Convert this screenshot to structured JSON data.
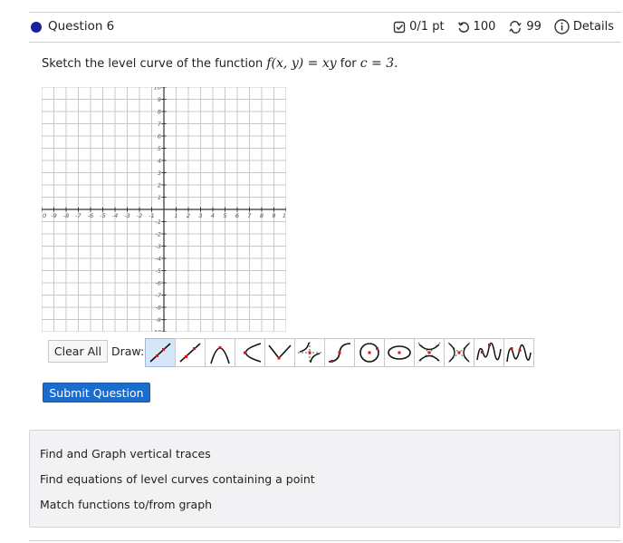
{
  "question": {
    "title": "Question 6",
    "points": "0/1 pt",
    "attempts": "100",
    "retries": "99",
    "details": "Details",
    "icons": [
      "checkbox-icon",
      "retry-icon",
      "cycle-icon",
      "info-icon"
    ]
  },
  "prompt": {
    "before": "Sketch the level curve of the function ",
    "function": "f(x, y) = xy",
    "middle": " for ",
    "condition": "c = 3."
  },
  "graph": {
    "x_min": -10,
    "x_max": 10,
    "y_min": -10,
    "y_max": 10,
    "x_tick_labels": [
      "-10",
      "-9",
      "-8",
      "-7",
      "-6",
      "-5",
      "-4",
      "-3",
      "-2",
      "-1",
      "1",
      "2",
      "3",
      "4",
      "5",
      "6",
      "7",
      "8",
      "9",
      "10"
    ],
    "y_tick_labels": [
      "10",
      "9",
      "8",
      "7",
      "6",
      "5",
      "4",
      "3",
      "2",
      "1",
      "-1",
      "-2",
      "-3",
      "-4",
      "-5",
      "-6",
      "-7",
      "-8",
      "-9",
      "-10"
    ],
    "grid": true,
    "colors": {
      "grid": "#c8c8c8",
      "axis": "#333333",
      "label": "#555555"
    }
  },
  "toolbar": {
    "clear_label": "Clear All",
    "draw_label": "Draw:",
    "tools": [
      {
        "name": "line-tool",
        "active": true
      },
      {
        "name": "segment-tool",
        "active": false
      },
      {
        "name": "parabola-tool",
        "active": false
      },
      {
        "name": "horizontal-parabola-tool",
        "active": false
      },
      {
        "name": "absolute-value-tool",
        "active": false
      },
      {
        "name": "hyperbola-asymptote-tool",
        "active": false
      },
      {
        "name": "cubic-tool",
        "active": false
      },
      {
        "name": "circle-tool",
        "active": false
      },
      {
        "name": "ellipse-tool",
        "active": false
      },
      {
        "name": "vertical-hyperbola-tool",
        "active": false
      },
      {
        "name": "horizontal-hyperbola-tool",
        "active": false
      },
      {
        "name": "sine-tool",
        "active": false
      },
      {
        "name": "cosine-tool",
        "active": false
      }
    ]
  },
  "submit_label": "Submit Question",
  "related": [
    "Find and Graph vertical traces",
    "Find equations of level curves containing a point",
    "Match functions to/from graph"
  ],
  "colors": {
    "accent": "#1c6cce",
    "dot": "#1c1f9a",
    "tool_active": "#d6e6f7",
    "curve_green": "#2f7d32",
    "point_red": "#e01010"
  }
}
